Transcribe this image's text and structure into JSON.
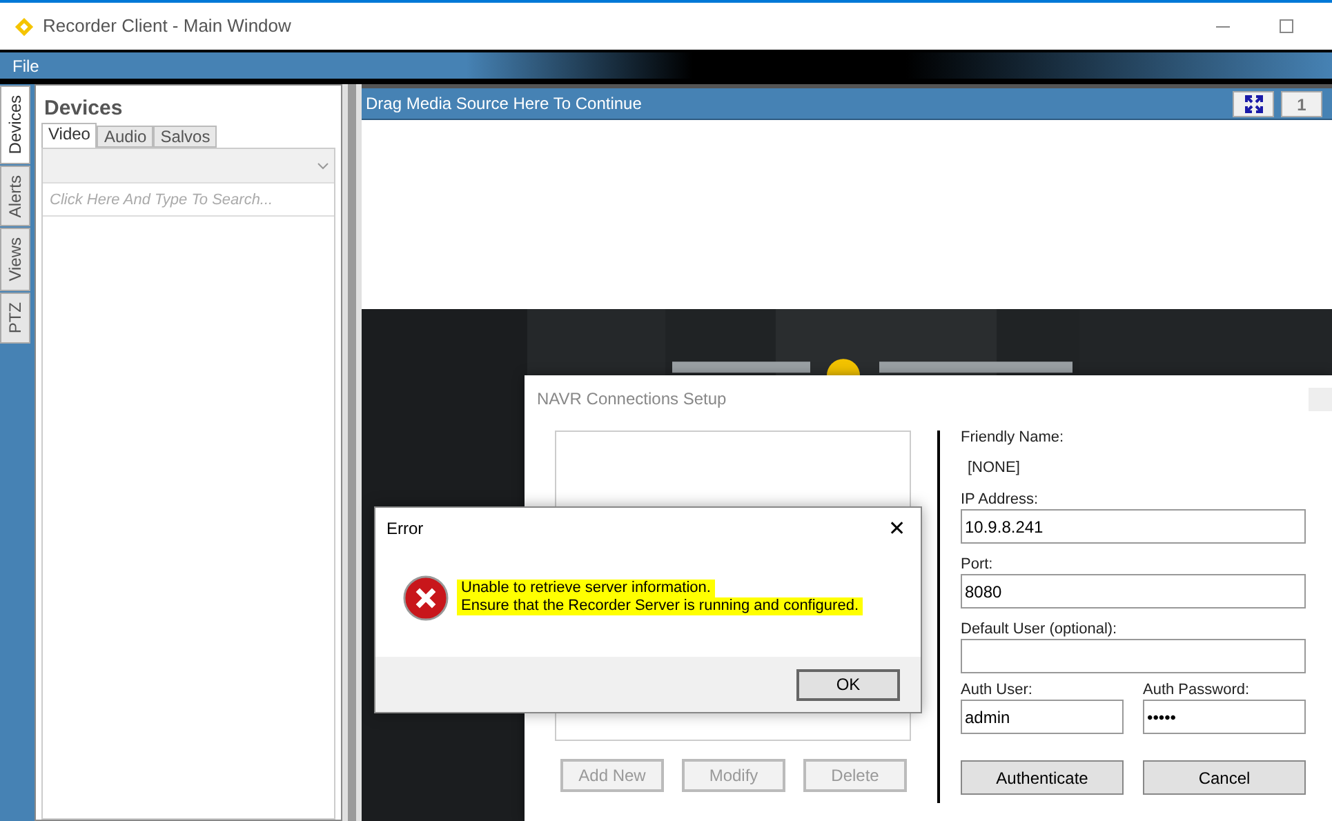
{
  "window": {
    "title": "Recorder Client - Main Window"
  },
  "menu": [
    "File"
  ],
  "side_tabs": [
    {
      "label": "Devices",
      "selected": true
    },
    {
      "label": "Alerts",
      "selected": false
    },
    {
      "label": "Views",
      "selected": false
    },
    {
      "label": "PTZ",
      "selected": false
    }
  ],
  "devices_panel": {
    "title": "Devices",
    "tabs": [
      {
        "label": "Video",
        "selected": true
      },
      {
        "label": "Audio",
        "selected": false
      },
      {
        "label": "Salvos",
        "selected": false
      }
    ],
    "search": {
      "placeholder": "Click Here And Type To Search..."
    }
  },
  "media_panel": {
    "header": "Drag Media Source Here To Continue",
    "layout_button": "1"
  },
  "navr_dialog": {
    "title": "NAVR Connections Setup",
    "buttons": [
      {
        "label": "Add New",
        "disabled": true
      },
      {
        "label": "Modify",
        "disabled": true
      },
      {
        "label": "Delete",
        "disabled": true
      }
    ],
    "friendly_name_label": "Friendly Name:",
    "friendly_name": "[NONE]",
    "fields": [
      {
        "label": "IP Address:",
        "value": "10.9.8.241"
      },
      {
        "label": "Port:",
        "value": "8080"
      },
      {
        "label": "Default User (optional):"
      }
    ],
    "auth_fields": [
      {
        "label": "Auth User:",
        "value": "admin"
      },
      {
        "label": "Auth Password:",
        "value": "•••••"
      }
    ],
    "actions": [
      {
        "label": "Authenticate",
        "disabled": false
      },
      {
        "label": "Cancel",
        "disabled": false
      }
    ]
  },
  "error_dialog": {
    "title": "Error",
    "close": "✕",
    "message_lines": [
      "Unable to retrieve server information.",
      "Ensure that the Recorder Server is running and configured."
    ],
    "button": "OK"
  }
}
